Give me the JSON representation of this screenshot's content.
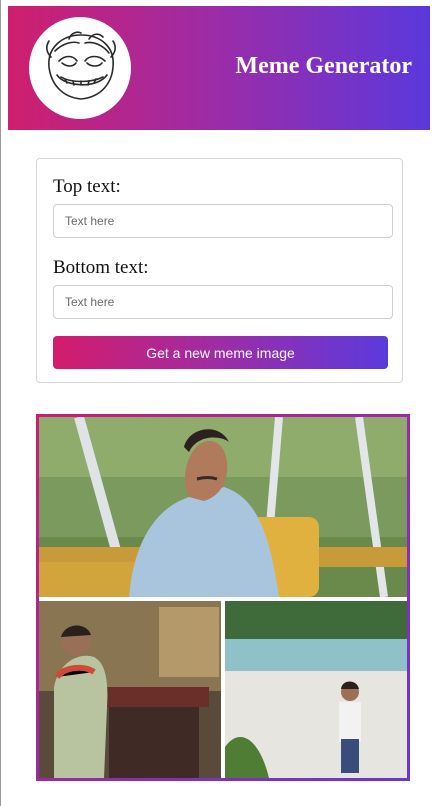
{
  "header": {
    "title": "Meme Generator",
    "logo_icon": "troll-face-icon",
    "gradient_start": "#cf1f6e",
    "gradient_end": "#5b38dc"
  },
  "form": {
    "top_label": "Top text:",
    "top_placeholder": "Text here",
    "bottom_label": "Bottom text:",
    "bottom_placeholder": "Text here",
    "button_label": "Get a new meme image"
  },
  "meme": {
    "image": "meme-image"
  }
}
